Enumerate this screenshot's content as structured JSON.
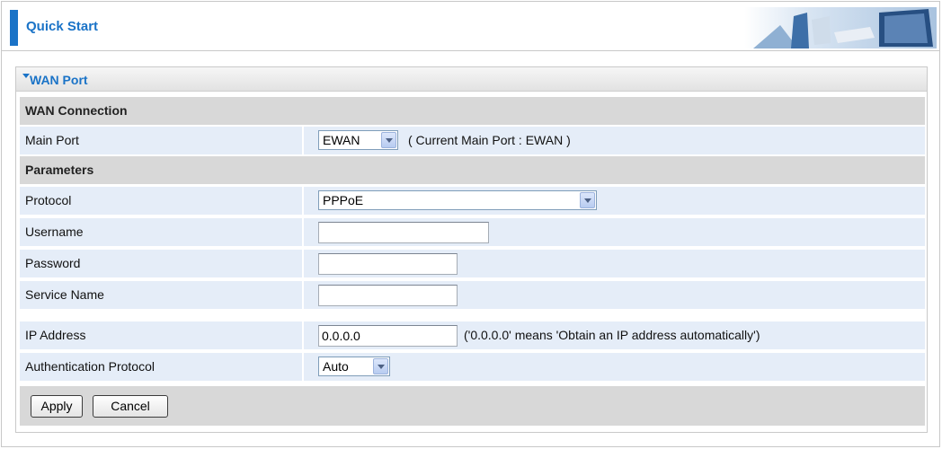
{
  "header": {
    "title": "Quick Start"
  },
  "panel": {
    "title": "WAN Port",
    "sections": {
      "connection": "WAN Connection",
      "parameters": "Parameters"
    },
    "main_port": {
      "label": "Main Port",
      "value": "EWAN",
      "note": "( Current Main Port : EWAN )"
    },
    "protocol": {
      "label": "Protocol",
      "value": "PPPoE"
    },
    "username": {
      "label": "Username",
      "value": ""
    },
    "password": {
      "label": "Password",
      "value": ""
    },
    "service_name": {
      "label": "Service Name",
      "value": ""
    },
    "ip_address": {
      "label": "IP Address",
      "value": "0.0.0.0",
      "note": "('0.0.0.0' means 'Obtain an IP address automatically')"
    },
    "auth_protocol": {
      "label": "Authentication Protocol",
      "value": "Auto"
    }
  },
  "buttons": {
    "apply": "Apply",
    "cancel": "Cancel"
  },
  "colors": {
    "accent": "#1a73c7",
    "row_bg": "#e5edf8",
    "section_bg": "#d8d8d8"
  }
}
